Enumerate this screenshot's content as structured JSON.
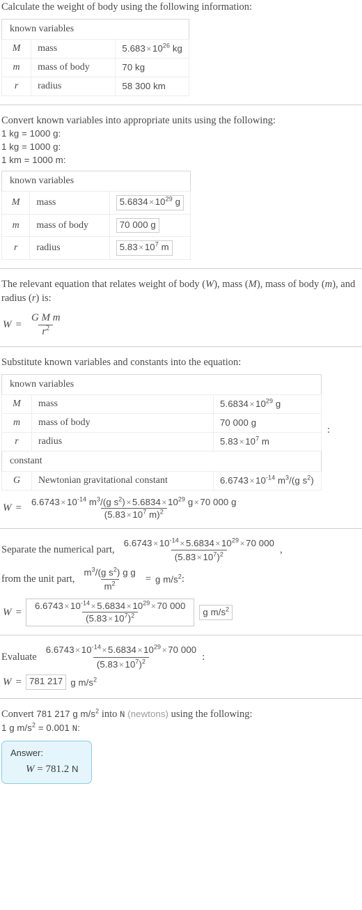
{
  "steps": {
    "s1": {
      "prompt": "Calculate the weight of body using the following information:",
      "table": {
        "header": "known variables",
        "rows": [
          {
            "symbol": "M",
            "name": "mass",
            "value_mantissa": "5.683",
            "value_exp": "26",
            "value_unit": "kg",
            "scientific": true
          },
          {
            "symbol": "m",
            "name": "mass of body",
            "value_plain": "70 kg",
            "scientific": false
          },
          {
            "symbol": "r",
            "name": "radius",
            "value_plain": "58 300 km",
            "scientific": false
          }
        ]
      }
    },
    "s2": {
      "prompt": "Convert known variables into appropriate units using the following:",
      "conversions": [
        "1 kg = 1000 g:",
        "1 kg = 1000 g:",
        "1 km = 1000 m:"
      ],
      "table": {
        "header": "known variables",
        "rows": [
          {
            "symbol": "M",
            "name": "mass",
            "value_mantissa": "5.6834",
            "value_exp": "29",
            "value_unit": "g",
            "scientific": true,
            "boxed": true
          },
          {
            "symbol": "m",
            "name": "mass of body",
            "value_plain": "70 000 g",
            "scientific": false,
            "boxed": true
          },
          {
            "symbol": "r",
            "name": "radius",
            "value_mantissa": "5.83",
            "value_exp": "7",
            "value_unit": "m",
            "scientific": true,
            "boxed": true
          }
        ]
      }
    },
    "s3": {
      "prompt_a": "The relevant equation that relates weight of body (",
      "prompt_var1": "W",
      "prompt_b": "), mass (",
      "prompt_var2": "M",
      "prompt_c": "), mass of body (",
      "prompt_var3": "m",
      "prompt_d": "), and radius (",
      "prompt_var4": "r",
      "prompt_e": ") is:",
      "equation": {
        "lhs": "W",
        "eq": "=",
        "numerator": "G M m",
        "denominator_base": "r",
        "denominator_exp": "2"
      }
    },
    "s4": {
      "prompt": "Substitute known variables and constants into the equation:",
      "table": {
        "header": "known variables",
        "header2": "constant",
        "rows": [
          {
            "symbol": "M",
            "name": "mass",
            "value_mantissa": "5.6834",
            "value_exp": "29",
            "value_unit": "g",
            "scientific": true
          },
          {
            "symbol": "m",
            "name": "mass of body",
            "value_plain": "70 000 g",
            "scientific": false
          },
          {
            "symbol": "r",
            "name": "radius",
            "value_mantissa": "5.83",
            "value_exp": "7",
            "value_unit": "m",
            "scientific": true
          }
        ],
        "constant_row": {
          "symbol": "G",
          "name": "Newtonian gravitational constant",
          "value_mantissa": "6.6743",
          "value_exp": "-14",
          "value_unit_num": "m",
          "value_unit_num_exp": "3",
          "value_unit_den": "/(g s",
          "value_unit_den_exp": "2",
          "value_unit_close": ")"
        }
      },
      "trailing_colon": ":",
      "equation": {
        "lhs": "W",
        "eq": "=",
        "num_g_mantissa": "6.6743",
        "num_g_exp": "-14",
        "num_g_unit_a": "m",
        "num_g_unit_a_exp": "3",
        "num_g_unit_b": "/(g s",
        "num_g_unit_b_exp": "2",
        "num_g_unit_c": ")",
        "num_M_mantissa": "5.6834",
        "num_M_exp": "29",
        "num_M_unit": "g",
        "num_m": "70 000 g",
        "den_mantissa": "5.83",
        "den_exp": "7",
        "den_unit": "m",
        "den_power": "2"
      }
    },
    "s5": {
      "prompt_a": "Separate the numerical part,",
      "prompt_comma": ",",
      "prompt_b": "from the unit part,",
      "numeric_fraction": {
        "n_mantissa_1": "6.6743",
        "n_exp_1": "-14",
        "n_mantissa_2": "5.6834",
        "n_exp_2": "29",
        "n_value_3": "70 000",
        "d_mantissa": "5.83",
        "d_exp": "7",
        "d_power": "2"
      },
      "unit_fraction": {
        "num_a": "m",
        "num_a_exp": "3",
        "num_b": "/(g s",
        "num_b_exp": "2",
        "num_c": ") g g",
        "den": "m",
        "den_exp": "2",
        "equals": "=",
        "result": "g m/s",
        "result_exp": "2",
        "colon": ":"
      },
      "equation": {
        "lhs": "W",
        "eq": "=",
        "unit_box": "g m/s",
        "unit_box_exp": "2"
      }
    },
    "s6": {
      "prompt": "Evaluate",
      "trailing_colon": ":",
      "result": {
        "lhs": "W",
        "eq": "=",
        "value": "781 217",
        "unit": "g m/s",
        "unit_exp": "2"
      }
    },
    "s7": {
      "prompt_a": "Convert",
      "prompt_value": "781 217",
      "prompt_unit": "g m/s",
      "prompt_unit_exp": "2",
      "prompt_b": "into",
      "prompt_target": "N",
      "prompt_target_long": "(newtons)",
      "prompt_c": "using the following:",
      "conversion_a": "1",
      "conversion_unit": "g m/s",
      "conversion_unit_exp": "2",
      "conversion_eq": "= 0.001",
      "conversion_target": "N",
      "conversion_colon": ":"
    },
    "s8": {
      "label": "Answer:",
      "lhs": "W",
      "eq": "=",
      "value": "781.2",
      "unit": "N"
    }
  },
  "colors": {
    "text": "#4a4a4a",
    "muted": "#9a9a9a",
    "table_border": "#d6d6d6",
    "cell_border": "#ededed",
    "separator": "#cfcfcf",
    "answer_bg": "#e4f6fb",
    "answer_border": "#84cfe0"
  }
}
